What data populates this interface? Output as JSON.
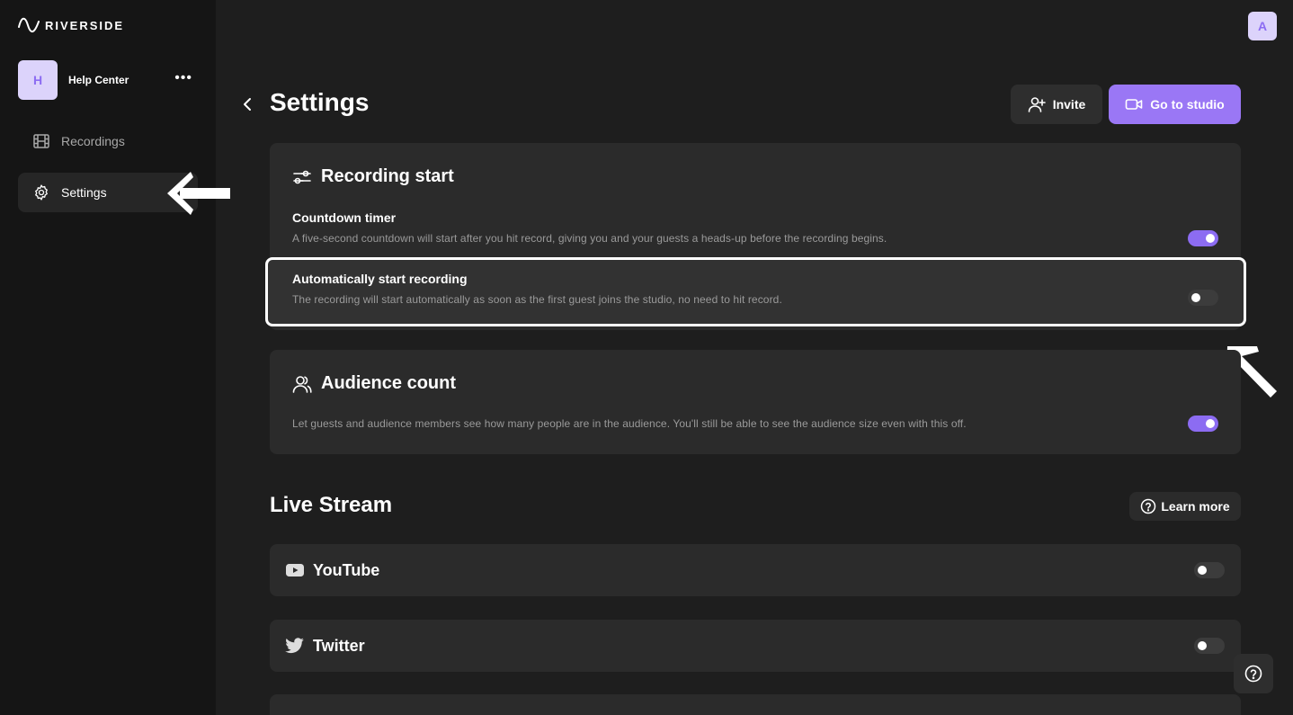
{
  "brand": {
    "logo_text": "RIVERSIDE"
  },
  "workspace": {
    "avatar_letter": "H",
    "name": "Help Center"
  },
  "sidebar": {
    "items": [
      {
        "label": "Recordings",
        "icon": "film-icon",
        "active": false
      },
      {
        "label": "Settings",
        "icon": "gear-icon",
        "active": true
      }
    ]
  },
  "user": {
    "avatar_letter": "A"
  },
  "page": {
    "title": "Settings"
  },
  "header": {
    "invite_label": "Invite",
    "studio_label": "Go to studio"
  },
  "recording_start": {
    "title": "Recording start",
    "countdown": {
      "label": "Countdown timer",
      "description": "A five-second countdown will start after you hit record, giving you and your guests a heads-up before the recording begins.",
      "enabled": true
    },
    "auto_start": {
      "label": "Automatically start recording",
      "description": "The recording will start automatically as soon as the first guest joins the studio, no need to hit record.",
      "enabled": false
    }
  },
  "audience_count": {
    "title": "Audience count",
    "description": "Let guests and audience members see how many people are in the audience. You'll still be able to see the audience size even with this off.",
    "enabled": true
  },
  "live_stream": {
    "title": "Live Stream",
    "learn_more_label": "Learn more",
    "platforms": [
      {
        "name": "YouTube",
        "icon": "youtube-icon",
        "enabled": false
      },
      {
        "name": "Twitter",
        "icon": "twitter-icon",
        "enabled": false
      }
    ]
  },
  "colors": {
    "accent": "#9a77f5",
    "toggle_on": "#8c6cf2",
    "background": "#1e1e1e",
    "sidebar": "#151515",
    "card": "#2b2b2b"
  }
}
